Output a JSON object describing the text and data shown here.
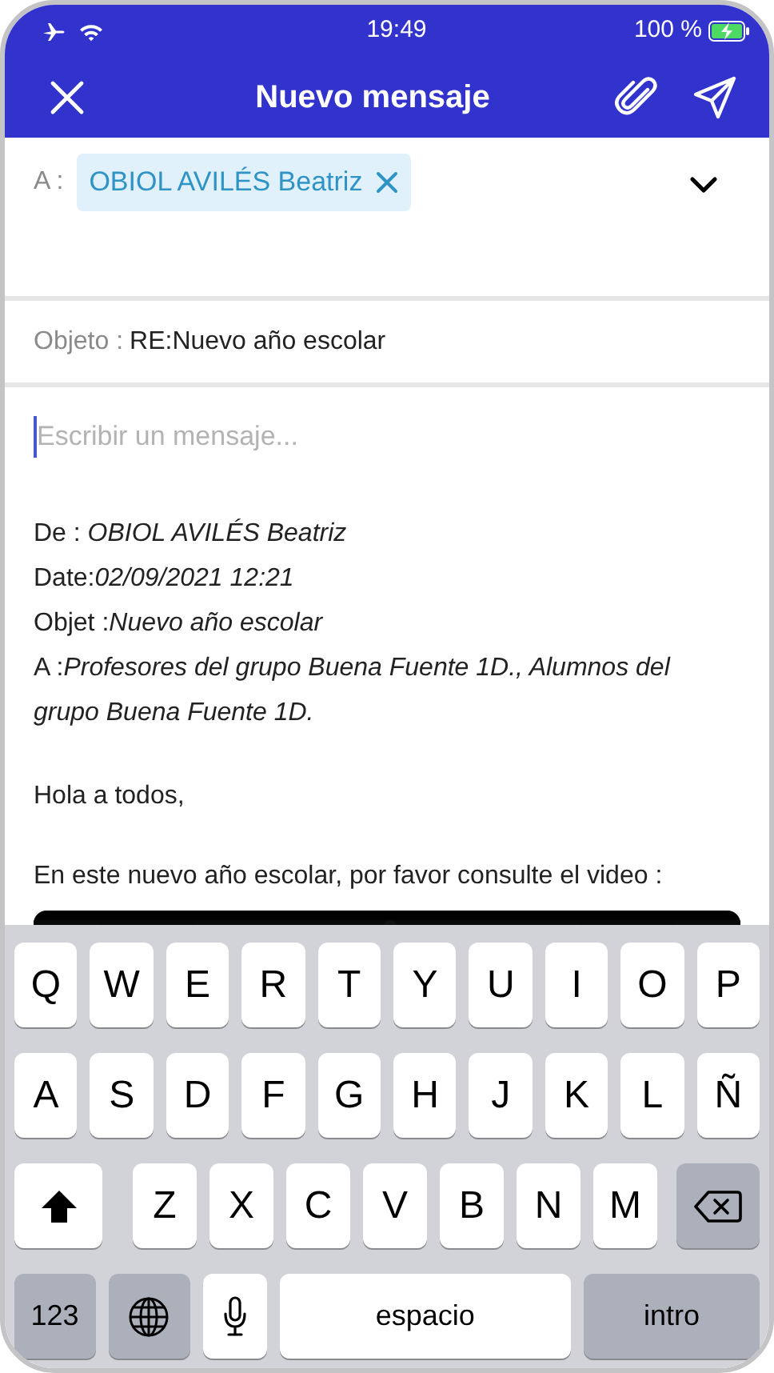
{
  "status_bar": {
    "time": "19:49",
    "battery": "100 %"
  },
  "header": {
    "title": "Nuevo mensaje"
  },
  "recipients": {
    "label": "A :",
    "chips": [
      {
        "name": "OBIOL AVILÉS Beatriz"
      }
    ]
  },
  "subject": {
    "label": "Objeto :",
    "value": "RE:Nuevo año escolar"
  },
  "message": {
    "placeholder": "Escribir un mensaje...",
    "quote": [
      "De : *OBIOL AVILÉS Beatriz*",
      "Date:*02/09/2021 12:21*",
      "Objet :*Nuevo año escolar*",
      "A :*Profesores del grupo Buena Fuente 1D., Alumnos del grupo Buena Fuente 1D.*"
    ],
    "paragraphs": [
      "Hola a todos,",
      "En este nuevo año escolar, por favor consulte el video :"
    ],
    "attachment": {
      "kind": "picture"
    }
  },
  "keyboard": {
    "top_row": [
      {
        "kind": "letter",
        "label": "Q"
      },
      {
        "kind": "letter",
        "label": "W"
      },
      {
        "kind": "letter",
        "label": "E"
      },
      {
        "kind": "letter",
        "label": "R"
      },
      {
        "kind": "letter",
        "label": "T"
      },
      {
        "kind": "letter",
        "label": "Y"
      },
      {
        "kind": "letter",
        "label": "U"
      },
      {
        "kind": "letter",
        "label": "I"
      },
      {
        "kind": "letter",
        "label": "O"
      },
      {
        "kind": "letter",
        "label": "P"
      }
    ],
    "middle_row": [
      {
        "kind": "letter",
        "label": "A"
      },
      {
        "kind": "letter",
        "label": "S"
      },
      {
        "kind": "letter",
        "label": "D"
      },
      {
        "kind": "letter",
        "label": "F"
      },
      {
        "kind": "letter",
        "label": "G"
      },
      {
        "kind": "letter",
        "label": "H"
      },
      {
        "kind": "letter",
        "label": "J"
      },
      {
        "kind": "letter",
        "label": "K"
      },
      {
        "kind": "letter",
        "label": "L"
      },
      {
        "kind": "letter",
        "label": "Ñ"
      }
    ],
    "bottom_row": [
      {
        "kind": "shift"
      },
      {
        "kind": "letter",
        "label": "Z"
      },
      {
        "kind": "letter",
        "label": "X"
      },
      {
        "kind": "letter",
        "label": "C"
      },
      {
        "kind": "letter",
        "label": "V"
      },
      {
        "kind": "letter",
        "label": "B"
      },
      {
        "kind": "letter",
        "label": "N"
      },
      {
        "kind": "letter",
        "label": "M"
      },
      {
        "kind": "backspace"
      }
    ],
    "function_row": [
      {
        "kind": "numbers",
        "label": "123"
      },
      {
        "kind": "globe"
      },
      {
        "kind": "mic"
      },
      {
        "kind": "space",
        "label": "espacio"
      },
      {
        "kind": "return",
        "label": "intro"
      }
    ]
  }
}
